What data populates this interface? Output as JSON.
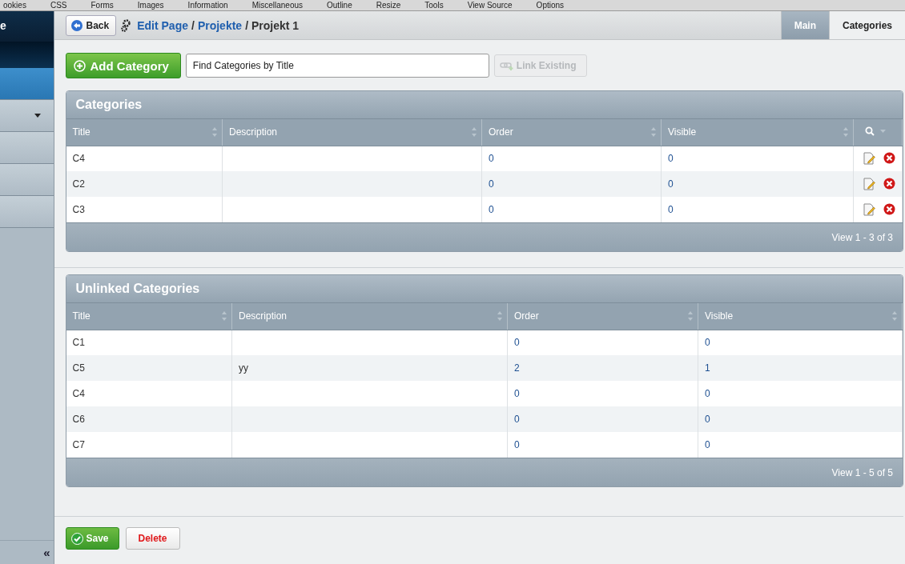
{
  "browser_toolbar": [
    "ookies",
    "CSS",
    "Forms",
    "Images",
    "Information",
    "Miscellaneous",
    "Outline",
    "Resize",
    "Tools",
    "View Source",
    "Options"
  ],
  "sidebar": {
    "title": "e",
    "items": [
      {
        "kind": "active"
      },
      {
        "kind": "dropdown"
      },
      {
        "kind": "plain"
      },
      {
        "kind": "plain"
      },
      {
        "kind": "plain"
      }
    ],
    "collapse": "«"
  },
  "header": {
    "back": "Back",
    "breadcrumb": [
      {
        "label": "Edit Page",
        "link": true
      },
      {
        "label": "Projekte",
        "link": true
      },
      {
        "label": "Projekt 1",
        "link": false
      }
    ],
    "separator": "/",
    "tabs": [
      {
        "label": "Main",
        "selected": false
      },
      {
        "label": "Categories",
        "selected": true
      }
    ]
  },
  "toolbar": {
    "add": "Add Category",
    "search": {
      "value": "Find Categories by Title"
    },
    "link_existing": {
      "label": "Link Existing",
      "disabled": true
    }
  },
  "panels": [
    {
      "title": "Categories",
      "actions": true,
      "columns": [
        "Title",
        "Description",
        "Order",
        "Visible"
      ],
      "rows": [
        [
          "C4",
          "",
          "0",
          "0"
        ],
        [
          "C2",
          "",
          "0",
          "0"
        ],
        [
          "C3",
          "",
          "0",
          "0"
        ]
      ],
      "footer": "View 1 - 3 of 3"
    },
    {
      "title": "Unlinked Categories",
      "actions": false,
      "columns": [
        "Title",
        "Description",
        "Order",
        "Visible"
      ],
      "rows": [
        [
          "C1",
          "",
          "0",
          "0"
        ],
        [
          "C5",
          "yy",
          "2",
          "1"
        ],
        [
          "C4",
          "",
          "0",
          "0"
        ],
        [
          "C6",
          "",
          "0",
          "0"
        ],
        [
          "C7",
          "",
          "0",
          "0"
        ]
      ],
      "footer": "View 1 - 5 of 5"
    }
  ],
  "buttons": {
    "save": "Save",
    "delete": "Delete"
  }
}
